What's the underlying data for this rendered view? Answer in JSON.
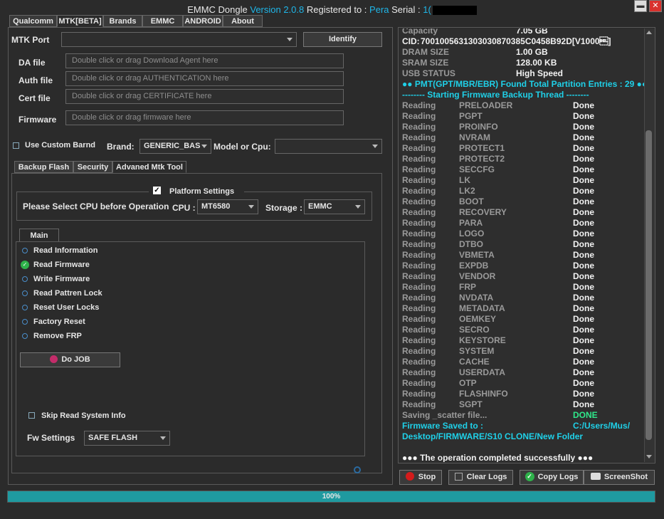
{
  "app": {
    "title_prefix": "EMMC Dongle",
    "version": "Version 2.0.8",
    "registered_label": "Registered to :",
    "registered_name": "Pera",
    "serial_label": "Serial :",
    "serial_visible": "1("
  },
  "window": {
    "minimize": "▬",
    "close": "✕"
  },
  "main_tabs": [
    "Qualcomm",
    "MTK[BETA]",
    "Brands",
    "EMMC",
    "ANDROID",
    "About"
  ],
  "left": {
    "mtk_port_label": "MTK Port",
    "identify_button": "Identify",
    "da_label": "DA file",
    "da_placeholder": "Double click or drag Download Agent here",
    "auth_label": "Auth file",
    "auth_placeholder": "Double click or drag AUTHENTICATION here",
    "cert_label": "Cert file",
    "cert_placeholder": "Double click or drag CERTIFICATE here",
    "firmware_label": "Firmware",
    "firmware_placeholder": "Double click or drag firmware here",
    "custom_brand_label": "Use Custom Barnd",
    "brand_label": "Brand:",
    "brand_value": "GENERIC_BAS",
    "model_label": "Model or Cpu:",
    "sub_tabs": [
      "Backup  Flash",
      "Security",
      "Advaned Mtk Tool"
    ],
    "platform_settings_label": "Platform Settings",
    "cpu_prompt": "Please Select CPU before Operation",
    "cpu_label": "CPU :",
    "cpu_value": "MT6580",
    "storage_label": "Storage :",
    "storage_value": "EMMC",
    "main_tab": "Main",
    "operations": [
      {
        "label": "Read Information",
        "selected": false
      },
      {
        "label": "Read Firmware",
        "selected": true
      },
      {
        "label": "Write Firmware",
        "selected": false
      },
      {
        "label": "Read Pattren Lock",
        "selected": false
      },
      {
        "label": "Reset User Locks",
        "selected": false
      },
      {
        "label": "Factory Reset",
        "selected": false
      },
      {
        "label": "Remove FRP",
        "selected": false
      }
    ],
    "do_job_button": "Do JOB",
    "skip_label": "Skip Read System Info",
    "fw_settings_label": "Fw Settings",
    "fw_settings_value": "SAFE FLASH"
  },
  "log": {
    "top_lines": [
      {
        "k": "Capacity",
        "v": "7.05 GB"
      },
      {
        "k": "CID:",
        "v": "7001005631303030870385C0458B92D[V1000\u0007]"
      },
      {
        "k": "DRAM SIZE",
        "v": "1.00 GB"
      },
      {
        "k": "SRAM SIZE",
        "v": "128.00 KB"
      },
      {
        "k": "USB STATUS",
        "v": "High Speed"
      }
    ],
    "pmt_line": "●● PMT(GPT/MBR/EBR) Found Total Partition Entries : 29 ●●",
    "thread_line": "-------- Starting Firmware Backup Thread --------",
    "reading_word": "Reading",
    "done_word": "Done",
    "partitions": [
      "PRELOADER",
      "PGPT",
      "PROINFO",
      "NVRAM",
      "PROTECT1",
      "PROTECT2",
      "SECCFG",
      "LK",
      "LK2",
      "BOOT",
      "RECOVERY",
      "PARA",
      "LOGO",
      "DTBO",
      "VBMETA",
      "EXPDB",
      "VENDOR",
      "FRP",
      "NVDATA",
      "METADATA",
      "OEMKEY",
      "SECRO",
      "KEYSTORE",
      "SYSTEM",
      "CACHE",
      "USERDATA",
      "OTP",
      "FLASHINFO",
      "SGPT"
    ],
    "saving_line": "Saving _scatter file...",
    "saving_status": "DONE",
    "saved_label": "Firmware Saved to :",
    "saved_path_1": "C:/Users/Mus/",
    "saved_path_2": "Desktop/FIRMWARE/S10 CLONE/New Folder",
    "completed_line": "●●● The operation completed successfully ●●●"
  },
  "buttons": {
    "stop": "Stop",
    "clear_logs": "Clear Logs",
    "copy_logs": "Copy Logs",
    "screenshot": "ScreenShot"
  },
  "progress": {
    "value_percent": 100,
    "label": "100%"
  },
  "colors": {
    "accent": "#1fb6e8",
    "progress": "#1f9aa0",
    "done_green": "#2ee88a"
  }
}
